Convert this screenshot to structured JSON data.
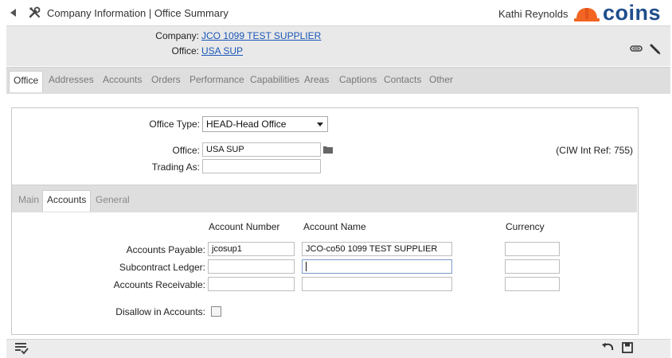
{
  "topbar": {
    "title": "Company Information | Office Summary",
    "user_name": "Kathi Reynolds",
    "brand": "coins"
  },
  "header": {
    "company_label": "Company:",
    "company_value": "JCO 1099 TEST SUPPLIER",
    "office_label": "Office:",
    "office_value": "USA SUP"
  },
  "main_tabs": [
    {
      "label": "Office",
      "active": true
    },
    {
      "label": "Addresses"
    },
    {
      "label": "Accounts"
    },
    {
      "label": "Orders"
    },
    {
      "label": "Performance"
    },
    {
      "label": "Capabilities"
    },
    {
      "label": "Areas"
    },
    {
      "label": "Captions"
    },
    {
      "label": "Contacts"
    },
    {
      "label": "Other"
    }
  ],
  "form": {
    "office_type_label": "Office Type:",
    "office_type_value": "HEAD-Head Office",
    "office_label": "Office:",
    "office_value": "USA SUP",
    "trading_as_label": "Trading As:",
    "trading_as_value": "",
    "int_ref": "(CIW Int Ref: 755)"
  },
  "sub_tabs": [
    {
      "label": "Main"
    },
    {
      "label": "Accounts",
      "active": true
    },
    {
      "label": "General"
    }
  ],
  "accounts": {
    "col_account_number": "Account Number",
    "col_account_name": "Account Name",
    "col_currency": "Currency",
    "rows": [
      {
        "label": "Accounts Payable:",
        "number": "jcosup1",
        "name": "JCO-co50 1099 TEST SUPPLIER",
        "currency": ""
      },
      {
        "label": "Subcontract Ledger:",
        "number": "",
        "name": "",
        "currency": ""
      },
      {
        "label": "Accounts Receivable:",
        "number": "",
        "name": "",
        "currency": ""
      }
    ],
    "disallow_label": "Disallow in Accounts:",
    "disallow_checked": false
  },
  "colors": {
    "brand": "#1f4e8c",
    "helmet": "#f26522",
    "link": "#1a56b8"
  },
  "icons": {
    "back": "back-arrow-icon",
    "tools": "tools-icon",
    "helmet": "hard-hat-icon",
    "attach": "paperclip-icon",
    "edit": "pencil-icon",
    "folder": "folder-icon",
    "tasks": "checklist-icon",
    "undo": "undo-icon",
    "save": "save-icon"
  }
}
